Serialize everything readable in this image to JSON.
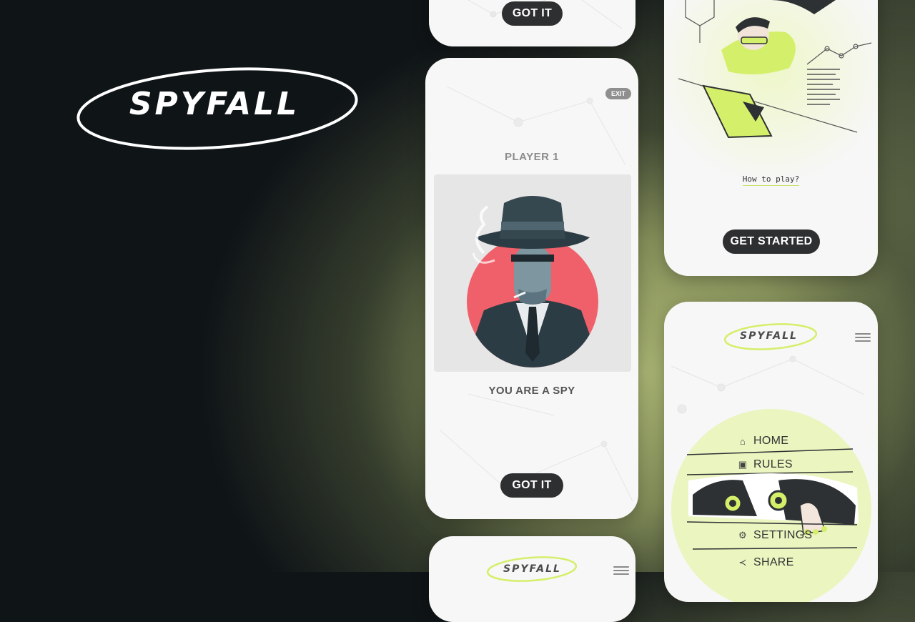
{
  "brand": {
    "logo_text": "SPYFALL"
  },
  "colors": {
    "accent": "#d4ef6a",
    "dark_button": "#2e2f30",
    "spy_red": "#f0606a",
    "spy_dark": "#35474f"
  },
  "card_top": {
    "button_label": "GOT IT"
  },
  "card_spy": {
    "exit_label": "EXIT",
    "player_label": "PLAYER 1",
    "role_text": "YOU ARE A SPY",
    "button_label": "GOT IT"
  },
  "card_intro": {
    "how_to_label": "How to play?",
    "button_label": "GET STARTED"
  },
  "card_menu": {
    "logo_text": "SPYFALL",
    "items": [
      {
        "label": "HOME",
        "icon": "home-icon"
      },
      {
        "label": "RULES",
        "icon": "rules-icon"
      },
      {
        "label": "SETTINGS",
        "icon": "gear-icon"
      },
      {
        "label": "SHARE",
        "icon": "share-icon"
      }
    ]
  },
  "card_bottom": {
    "logo_text": "SPYFALL"
  }
}
